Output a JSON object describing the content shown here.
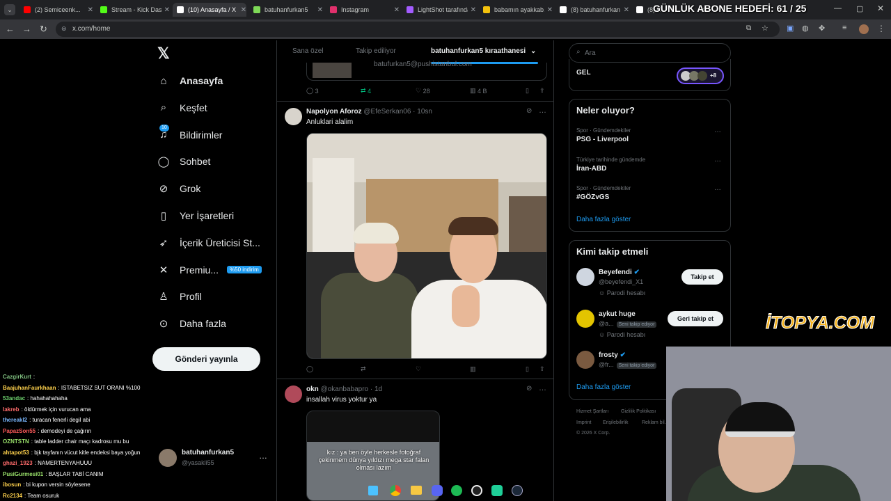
{
  "browser": {
    "tabs": [
      {
        "label": "(2) Semiceenk...",
        "color": "#ff0000"
      },
      {
        "label": "Stream - Kick Dash",
        "color": "#53fc18"
      },
      {
        "label": "(10) Anasayfa / X",
        "color": "#ffffff"
      },
      {
        "label": "batuhanfurkan5",
        "color": "#7ed957"
      },
      {
        "label": "Instagram",
        "color": "#e1306c"
      },
      {
        "label": "LightShot tarafından",
        "color": "#a35cff"
      },
      {
        "label": "babamın ayakkab...",
        "color": "#f4c20d"
      },
      {
        "label": "(8) batuhanfurkan",
        "color": "#ffffff"
      },
      {
        "label": "(8) X",
        "color": "#ffffff"
      }
    ],
    "url": "x.com/home"
  },
  "overlay": {
    "abone": "GÜNLÜK ABONE HEDEFİ: 61 / 25",
    "itopya": "İTOPYA.COM"
  },
  "sidebar": {
    "items": [
      {
        "label": "Anasayfa",
        "icon": "home-icon"
      },
      {
        "label": "Keşfet",
        "icon": "search-icon"
      },
      {
        "label": "Bildirimler",
        "icon": "bell-icon",
        "badge": "10"
      },
      {
        "label": "Sohbet",
        "icon": "chat-icon"
      },
      {
        "label": "Grok",
        "icon": "grok-icon"
      },
      {
        "label": "Yer İşaretleri",
        "icon": "bookmark-icon"
      },
      {
        "label": "İçerik Üreticisi St...",
        "icon": "rocket-icon"
      },
      {
        "label": "Premiu...",
        "icon": "x-icon",
        "badge": "%50 indirim"
      },
      {
        "label": "Profil",
        "icon": "person-icon"
      },
      {
        "label": "Daha fazla",
        "icon": "more-icon"
      }
    ],
    "post_button": "Gönderi yayınla",
    "account": {
      "name": "batuhanfurkan5",
      "handle": "@yasakli55"
    }
  },
  "feed": {
    "tabs": [
      "Sana özel",
      "Takip ediliyor",
      "batuhanfurkan5 kıraathanesi"
    ],
    "top_tweet": {
      "email": "batufurkan5@pushistanbul.com",
      "replies": "3",
      "reposts": "4",
      "likes": "28",
      "views": "4 B"
    },
    "tweet1": {
      "name": "Napolyon Aforoz",
      "handle": "@EfeSerkan06",
      "time": "· 10sn",
      "text": "Anluklari alalim"
    },
    "tweet2": {
      "name": "okn",
      "handle": "@okanbabapro",
      "time": "· 1d",
      "text": "insallah virus yoktur ya",
      "image_caption": "kız : ya ben öyle herkesle fotoğraf çekinmem dünya yıldızı mega star falan olması lazım"
    }
  },
  "right": {
    "search_placeholder": "Ara",
    "gel": "GEL",
    "gel_count": "+8",
    "trends_title": "Neler oluyor?",
    "trends": [
      {
        "category": "Spor · Gündemdekiler",
        "name": "PSG - Liverpool"
      },
      {
        "category": "Türkiye tarihinde gündemde",
        "name": "İran-ABD"
      },
      {
        "category": "Spor · Gündemdekiler",
        "name": "#GÖZvGS"
      }
    ],
    "show_more": "Daha fazla göster",
    "who_title": "Kimi takip etmeli",
    "who": [
      {
        "name": "Beyefendi",
        "handle": "@beyefendi_X1",
        "note": "Parodi hesabı",
        "button": "Takip et",
        "verified": true
      },
      {
        "name": "aykut huge",
        "handle": "@a...",
        "tag": "Seni takip ediyor",
        "note": "Parodi hesabı",
        "button": "Geri takip et"
      },
      {
        "name": "frosty",
        "handle": "@fr...",
        "tag": "Seni takip ediyor",
        "verified": true
      }
    ],
    "who_more": "Daha fazla göster",
    "footer": [
      "Hizmet Şartları",
      "Gizlilik Politikası",
      "Imprint",
      "Erişilebilirlik",
      "Reklam bil...",
      "© 2026 X Corp."
    ]
  },
  "chat": [
    {
      "user": "CazgirKurt",
      "msg": ":",
      "color": "#7fbf7f"
    },
    {
      "user": "BaajuhanFaurkhaan",
      "msg": ": ISTABETSIZ SUT ORANI %100",
      "color": "#ffd24d"
    },
    {
      "user": "53andac",
      "msg": ": hahahahahaha",
      "color": "#6fd36f"
    },
    {
      "user": "Iakreb",
      "msg": ": öldürmek için vurucan ama",
      "color": "#ff6b6b"
    },
    {
      "user": "thereakl2",
      "msg": ": turacan fenerli degil abi",
      "color": "#7ab8ff"
    },
    {
      "user": "PapazSon55",
      "msg": ": demodeyi de çağırın",
      "color": "#ff5a5a"
    },
    {
      "user": "OZNTSTN",
      "msg": ": table ladder chair maçı kadrosu mu bu",
      "color": "#9be36b"
    },
    {
      "user": "ahtapot53",
      "msg": ": bjk tayfanın vücut kitle endeksi baya yoğun",
      "color": "#ffd24d"
    },
    {
      "user": "ghazi_1923",
      "msg": ": NAMERTENYAHUUU",
      "color": "#ff6b6b"
    },
    {
      "user": "PusiGurmesi01",
      "msg": ": BAŞLAR TABİ CANIM",
      "color": "#9be36b"
    },
    {
      "user": "ibosun",
      "msg": ": bi kupon versin söylesene",
      "color": "#ffd24d"
    },
    {
      "user": "Rc2134",
      "msg": ": Team osuruk",
      "color": "#ffd24d"
    }
  ]
}
